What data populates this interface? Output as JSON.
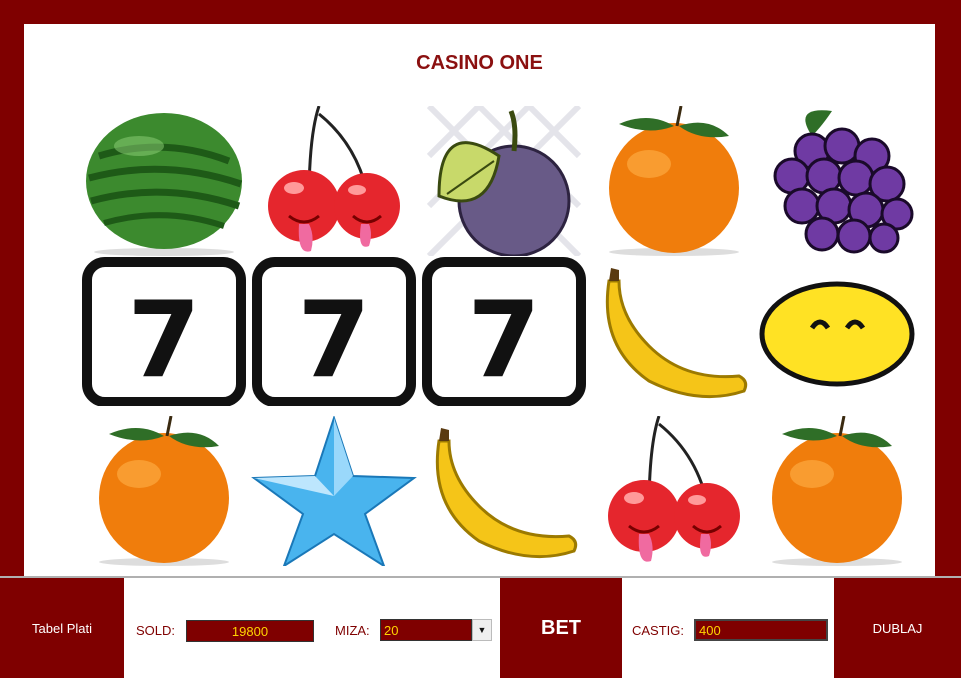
{
  "title": "CASINO ONE",
  "reels": [
    [
      "watermelon",
      "cherries",
      "plum",
      "orange",
      "grapes"
    ],
    [
      "seven",
      "seven",
      "seven",
      "banana",
      "lemon"
    ],
    [
      "orange",
      "star",
      "banana",
      "cherries",
      "orange"
    ]
  ],
  "seven_label": "7",
  "controls": {
    "paytable_label": "Tabel Plati",
    "sold_label": "SOLD:",
    "sold_value": "19800",
    "miza_label": "MIZA:",
    "miza_value": "20",
    "bet_label": "BET",
    "castig_label": "CASTIG:",
    "castig_value": "400",
    "dublaj_label": "DUBLAJ"
  },
  "colors": {
    "frame": "#7f0000",
    "accent_text": "#ffd400",
    "title": "#8b1010"
  }
}
